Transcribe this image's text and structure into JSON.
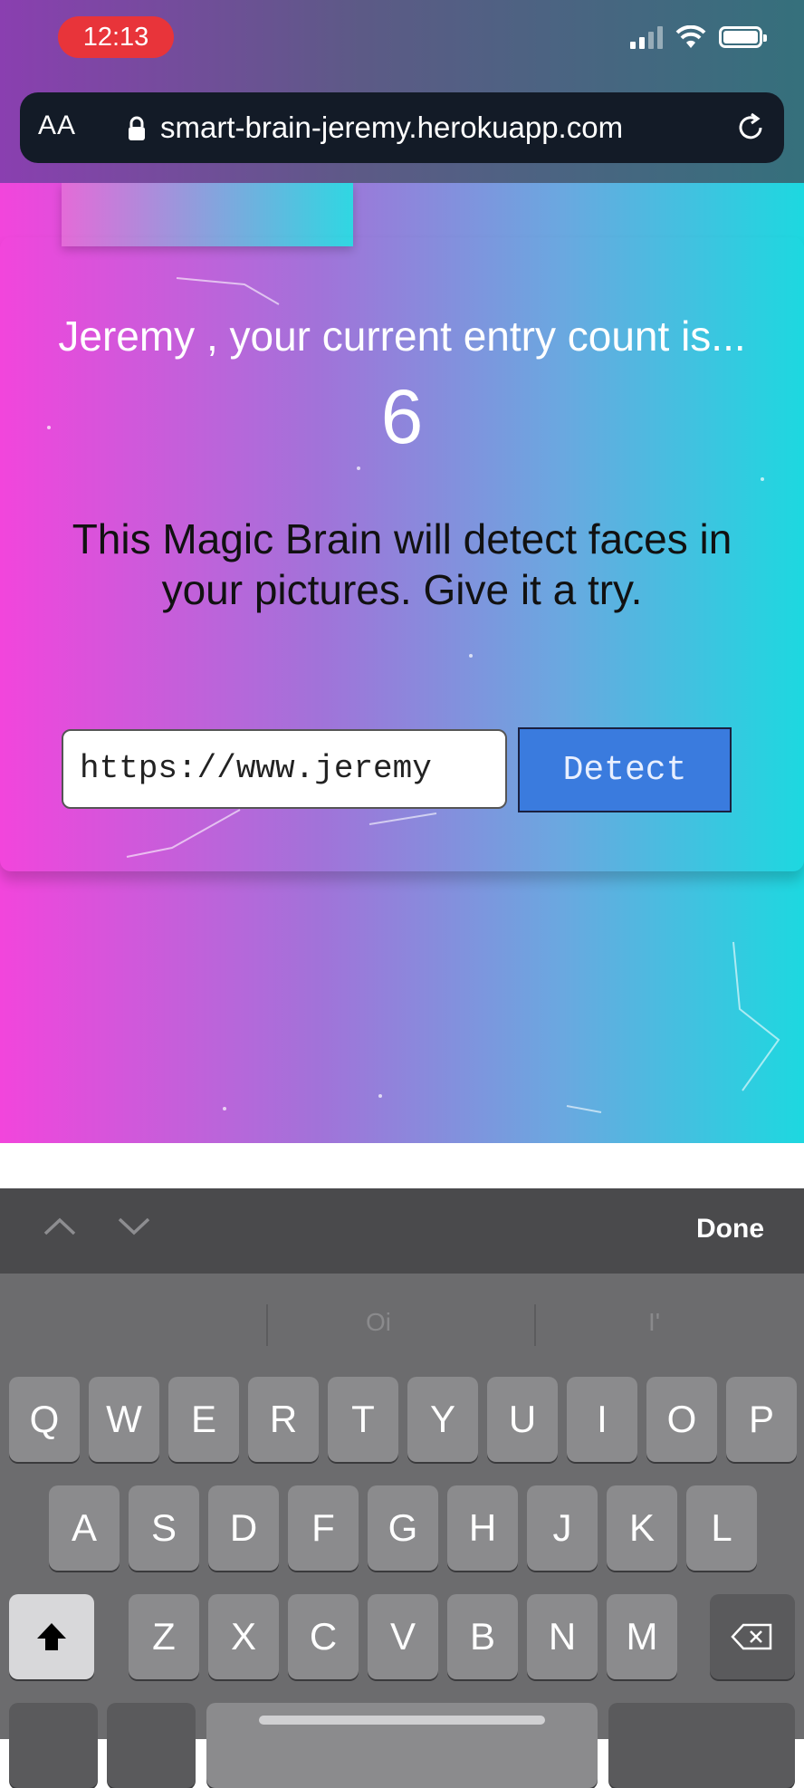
{
  "status_bar": {
    "time": "12:13"
  },
  "address_bar": {
    "aa_label": "AA",
    "url": "smart-brain-jeremy.herokuapp.com"
  },
  "page": {
    "entry_text": "Jeremy , your current entry count is...",
    "entry_count": "6",
    "description": "This Magic Brain will detect faces in your pictures. Give it a try.",
    "image_url_value": "https://www.jeremy",
    "detect_label": "Detect"
  },
  "keyboard_bar": {
    "done_label": "Done"
  },
  "keyboard": {
    "suggestions": [
      "",
      "Oi",
      "I'"
    ],
    "row1": [
      "Q",
      "W",
      "E",
      "R",
      "T",
      "Y",
      "U",
      "I",
      "O",
      "P"
    ],
    "row2": [
      "A",
      "S",
      "D",
      "F",
      "G",
      "H",
      "J",
      "K",
      "L"
    ],
    "row3": [
      "Z",
      "X",
      "C",
      "V",
      "B",
      "N",
      "M"
    ]
  },
  "colors": {
    "gradient_left": "#f245dc",
    "gradient_right": "#1dd8e0",
    "detect_button": "#3a7bde",
    "time_pill": "#e8343a"
  }
}
